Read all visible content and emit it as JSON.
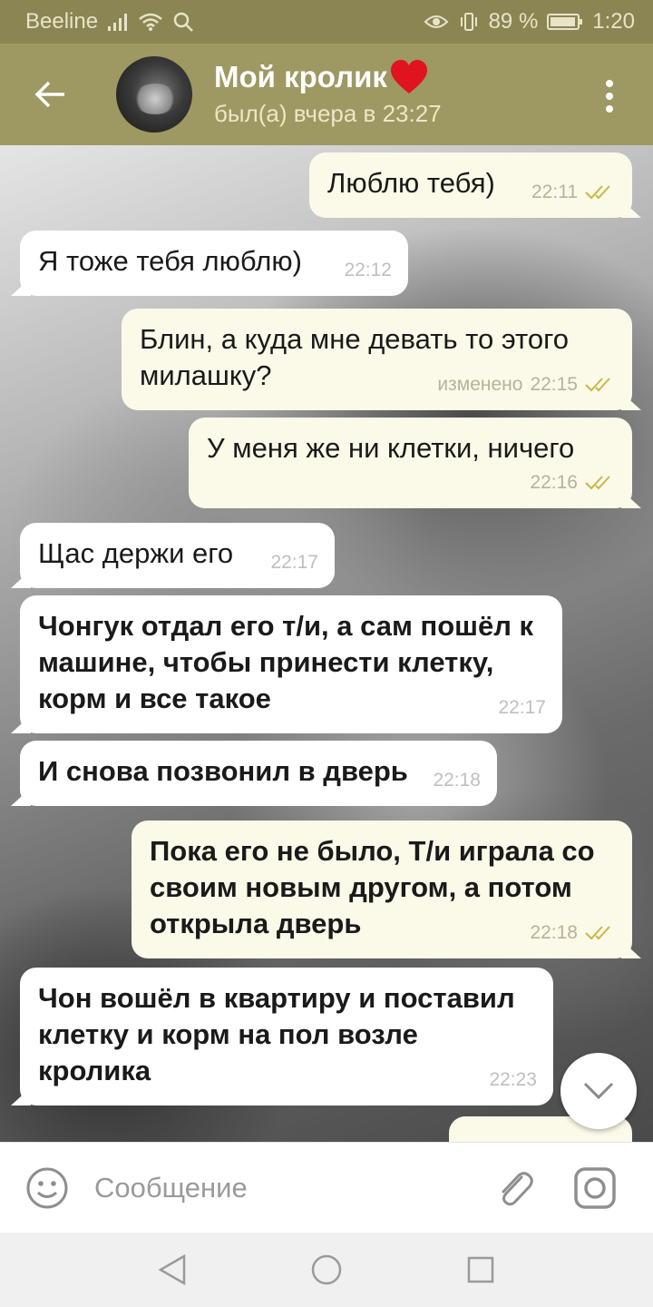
{
  "status_bar": {
    "carrier": "Beeline",
    "battery_percent": "89 %",
    "time": "1:20"
  },
  "header": {
    "title": "Мой кролик",
    "title_emoji": "❤️",
    "status": "был(а) вчера в 23:27"
  },
  "messages": [
    {
      "dir": "out",
      "text": "Люблю тебя)",
      "time": "22:11",
      "edited": "",
      "read": true
    },
    {
      "dir": "in",
      "text": "Я тоже тебя люблю)",
      "time": "22:12",
      "edited": ""
    },
    {
      "dir": "out",
      "text": "Блин, а куда мне девать то этого милашку?",
      "time": "22:15",
      "edited": "изменено",
      "read": true
    },
    {
      "dir": "out",
      "text": "У меня же ни клетки, ничего",
      "time": "22:16",
      "edited": "",
      "read": true
    },
    {
      "dir": "in",
      "text": "Щас держи его",
      "time": "22:17",
      "edited": ""
    },
    {
      "dir": "in",
      "text": "Чонгук отдал его т/и, а сам пошёл к машине, чтобы принести клетку, корм и все такое",
      "time": "22:17",
      "edited": ""
    },
    {
      "dir": "in",
      "text": "И снова позвонил в дверь",
      "time": "22:18",
      "edited": ""
    },
    {
      "dir": "out",
      "text": "Пока его не было, Т/и играла со своим новым другом, а потом открыла дверь",
      "time": "22:18",
      "edited": "",
      "read": true
    },
    {
      "dir": "in",
      "text": "Чон вошёл в квартиру и поставил клетку и корм на пол возле кролика",
      "time": "22:23",
      "edited": ""
    }
  ],
  "input": {
    "placeholder": "Сообщение"
  },
  "colors": {
    "header_bg": "#9e9862",
    "status_bar_bg": "#8b8553",
    "outgoing_bubble": "#fbf9e8",
    "incoming_bubble": "#ffffff",
    "read_check": "#c8b84a"
  },
  "icons": [
    "back-arrow-icon",
    "more-vertical-icon",
    "double-check-icon",
    "chevron-down-icon",
    "emoji-icon",
    "paperclip-icon",
    "camera-icon",
    "nav-back-icon",
    "nav-home-icon",
    "nav-recents-icon"
  ]
}
